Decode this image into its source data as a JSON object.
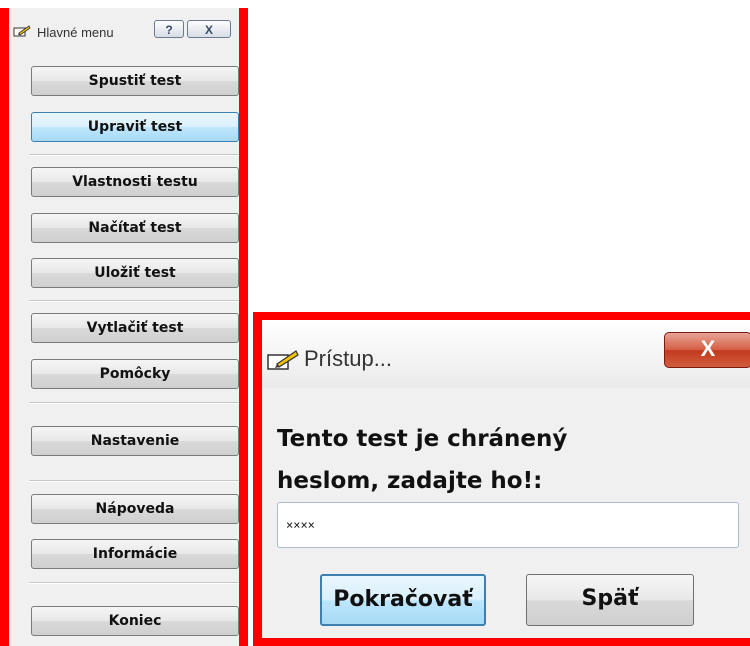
{
  "menu_window": {
    "title": "Hlavné menu",
    "help_label": "?",
    "close_label": "X",
    "items": [
      {
        "label": "Spustiť test"
      },
      {
        "label": "Upraviť test"
      },
      {
        "label": "Vlastnosti testu"
      },
      {
        "label": "Načítať test"
      },
      {
        "label": "Uložiť test"
      },
      {
        "label": "Vytlačiť test"
      },
      {
        "label": "Pomôcky"
      },
      {
        "label": "Nastavenie"
      },
      {
        "label": "Nápoveda"
      },
      {
        "label": "Informácie"
      },
      {
        "label": "Koniec"
      }
    ],
    "highlighted_item": "Upraviť test"
  },
  "dialog": {
    "title": "Prístup...",
    "close_label": "X",
    "prompt_line1": "Tento test je chránený",
    "prompt_line2": "heslom, zadajte ho!:",
    "password_value": "××××",
    "continue_label": "Pokračovať",
    "back_label": "Späť"
  },
  "colors": {
    "frame_highlight": "#ff0000",
    "window_bg": "#f0f0f0",
    "active_button": "#bee6fd",
    "close_button": "#c13a1d"
  },
  "icons": {
    "app": "pencil-notepad-icon",
    "help": "question-mark-icon",
    "close": "close-icon"
  }
}
